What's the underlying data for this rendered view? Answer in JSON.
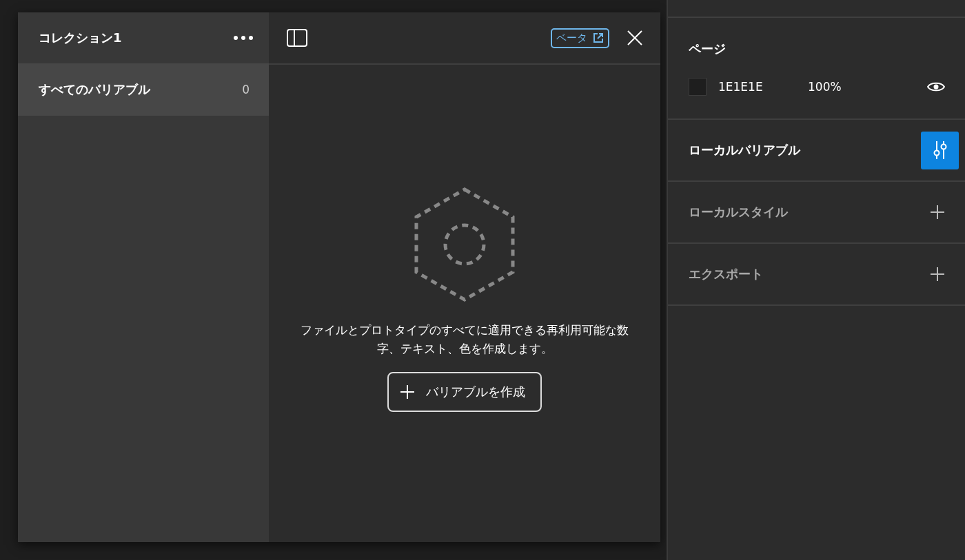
{
  "dialog": {
    "sidebar": {
      "title": "コレクション1",
      "items": [
        {
          "label": "すべてのバリアブル",
          "count": "0",
          "selected": true
        }
      ]
    },
    "toolbar": {
      "badge": "ベータ"
    },
    "empty_state": {
      "message": "ファイルとプロトタイプのすべてに適用できる再利用可能な数字、テキスト、色を作成します。",
      "button": "バリアブルを作成"
    }
  },
  "panel": {
    "sections": [
      {
        "kind": "fill",
        "title": "ページ",
        "dimmed": false,
        "hex": "1E1E1E",
        "color": "#1e1e1e",
        "opacity": "100%"
      },
      {
        "kind": "action",
        "title": "ローカルバリアブル",
        "dimmed": false,
        "selected": true
      },
      {
        "kind": "add",
        "title": "ローカルスタイル",
        "dimmed": true
      },
      {
        "kind": "add",
        "title": "エクスポート",
        "dimmed": true
      }
    ]
  }
}
